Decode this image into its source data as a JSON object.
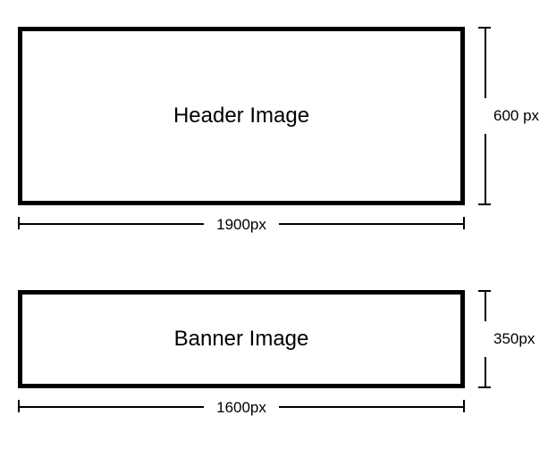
{
  "header": {
    "label": "Header Image",
    "width_label": "1900px",
    "height_label": "600 px"
  },
  "banner": {
    "label": "Banner Image",
    "width_label": "1600px",
    "height_label": "350px"
  }
}
